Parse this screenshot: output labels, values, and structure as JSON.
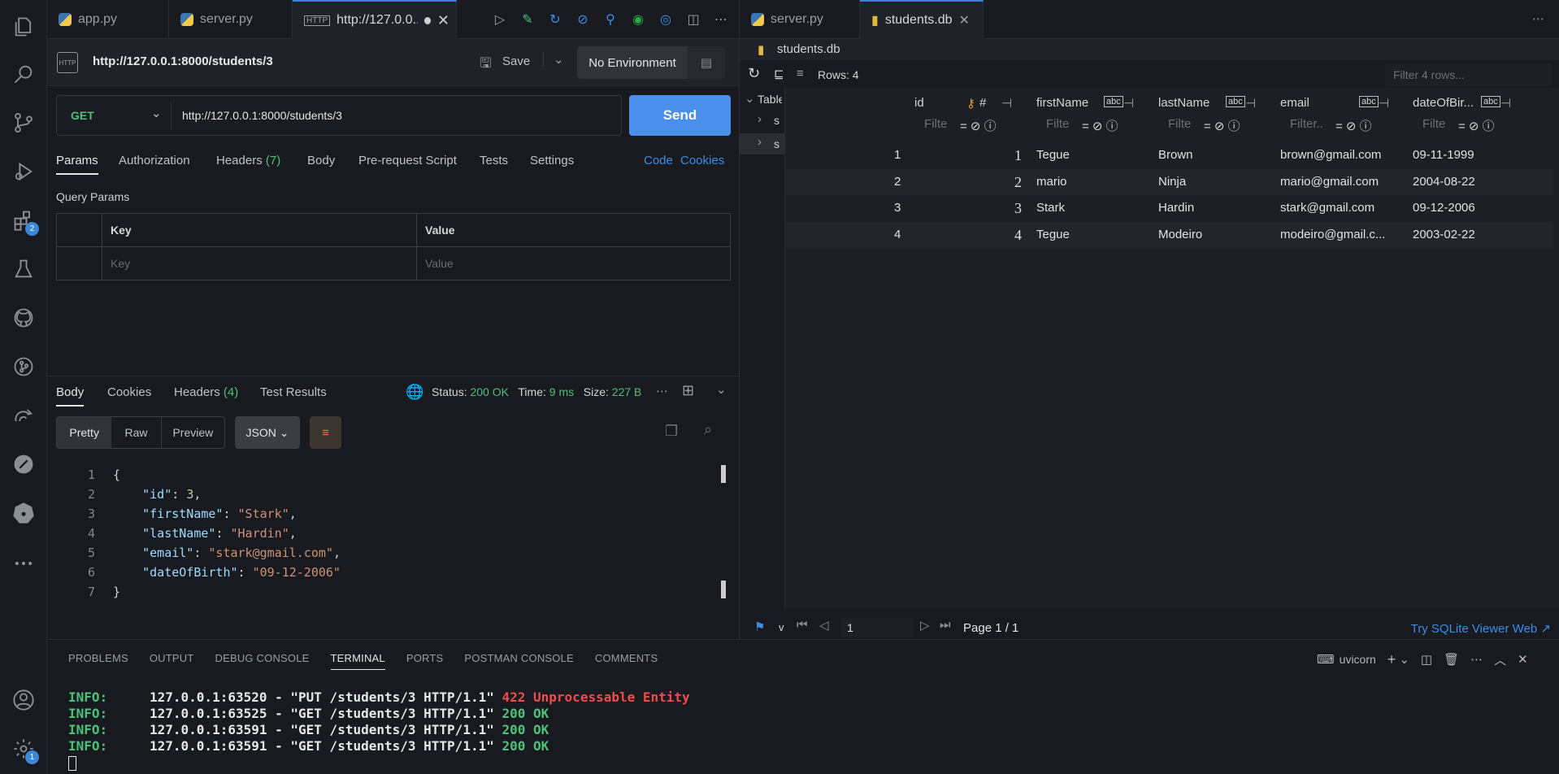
{
  "activity_bar": {
    "icons": [
      "files-icon",
      "search-icon",
      "source-control-icon",
      "run-debug-icon",
      "extensions-icon",
      "testing-icon",
      "github-icon",
      "git-graph-icon",
      "remote-icon",
      "postman-icon",
      "kubernetes-icon",
      "more-icon"
    ],
    "extensions_badge": "2",
    "settings_badge": "1",
    "bottom_icons": [
      "account-icon",
      "settings-gear-icon"
    ]
  },
  "left_tabs": [
    {
      "label": "app.py",
      "icon": "python-icon"
    },
    {
      "label": "server.py",
      "icon": "python-icon"
    },
    {
      "label": "http://127.0.0....",
      "icon": "http-icon",
      "active": true
    }
  ],
  "right_tabs": [
    {
      "label": "server.py",
      "icon": "python-icon"
    },
    {
      "label": "students.db",
      "icon": "database-icon",
      "active": true
    }
  ],
  "request": {
    "title": "http://127.0.0.1:8000/students/3",
    "save_label": "Save",
    "environment": "No Environment",
    "method": "GET",
    "url": "http://127.0.0.1:8000/students/3",
    "send_label": "Send",
    "tabs": [
      "Params",
      "Authorization",
      "Headers",
      "Body",
      "Pre-request Script",
      "Tests",
      "Settings"
    ],
    "headers_count": "(7)",
    "code_link": "Code",
    "cookies_link": "Cookies",
    "query_params_title": "Query Params",
    "key_header": "Key",
    "value_header": "Value",
    "key_placeholder": "Key",
    "value_placeholder": "Value"
  },
  "response": {
    "tabs": [
      "Body",
      "Cookies",
      "Headers",
      "Test Results"
    ],
    "headers_count": "(4)",
    "status_label": "Status:",
    "status_value": "200 OK",
    "time_label": "Time:",
    "time_value": "9 ms",
    "size_label": "Size:",
    "size_value": "227 B",
    "view_modes": [
      "Pretty",
      "Raw",
      "Preview"
    ],
    "format": "JSON",
    "body_lines": [
      {
        "n": "1",
        "text": "{"
      },
      {
        "n": "2",
        "key": "\"id\"",
        "val": "3",
        "type": "num",
        "comma": ","
      },
      {
        "n": "3",
        "key": "\"firstName\"",
        "val": "\"Stark\"",
        "type": "str",
        "comma": ","
      },
      {
        "n": "4",
        "key": "\"lastName\"",
        "val": "\"Hardin\"",
        "type": "str",
        "comma": ","
      },
      {
        "n": "5",
        "key": "\"email\"",
        "val": "\"stark@gmail.com\"",
        "type": "str",
        "comma": ","
      },
      {
        "n": "6",
        "key": "\"dateOfBirth\"",
        "val": "\"09-12-2006\"",
        "type": "str",
        "comma": ""
      },
      {
        "n": "7",
        "text": "}"
      }
    ]
  },
  "db": {
    "file": "students.db",
    "rows_label": "Rows: 4",
    "filter_placeholder": "Filter 4 rows...",
    "sidebar_label": "Table",
    "tree_items": [
      "s",
      "s"
    ],
    "columns": [
      "id",
      "firstName",
      "lastName",
      "email",
      "dateOfBir..."
    ],
    "column_filters": [
      "Filte",
      "Filte",
      "Filte",
      "Filter..",
      "Filte"
    ],
    "rows": [
      {
        "rownum": "1",
        "id": "1",
        "firstName": "Tegue",
        "lastName": "Brown",
        "email": "brown@gmail.com",
        "dob": "09-11-1999"
      },
      {
        "rownum": "2",
        "id": "2",
        "firstName": "mario",
        "lastName": "Ninja",
        "email": "mario@gmail.com",
        "dob": "2004-08-22"
      },
      {
        "rownum": "3",
        "id": "3",
        "firstName": "Stark",
        "lastName": "Hardin",
        "email": "stark@gmail.com",
        "dob": "09-12-2006"
      },
      {
        "rownum": "4",
        "id": "4",
        "firstName": "Tegue",
        "lastName": "Modeiro",
        "email": "modeiro@gmail.c...",
        "dob": "2003-02-22"
      }
    ],
    "footer_v": "v",
    "page_input": "1",
    "page_label": "Page 1 / 1",
    "try_link": "Try SQLite Viewer Web ↗"
  },
  "panel": {
    "tabs": [
      "PROBLEMS",
      "OUTPUT",
      "DEBUG CONSOLE",
      "TERMINAL",
      "PORTS",
      "POSTMAN CONSOLE",
      "COMMENTS"
    ],
    "active_tab": "TERMINAL",
    "terminal_name": "uvicorn",
    "lines": [
      {
        "level": "INFO:",
        "addr": "127.0.0.1:63520 - \"PUT /students/3 HTTP/1.1\"",
        "status": "422 Unprocessable Entity",
        "ok": false
      },
      {
        "level": "INFO:",
        "addr": "127.0.0.1:63525 - \"GET /students/3 HTTP/1.1\"",
        "status": "200 OK",
        "ok": true
      },
      {
        "level": "INFO:",
        "addr": "127.0.0.1:63591 - \"GET /students/3 HTTP/1.1\"",
        "status": "200 OK",
        "ok": true
      },
      {
        "level": "INFO:",
        "addr": "127.0.0.1:63591 - \"GET /students/3 HTTP/1.1\"",
        "status": "200 OK",
        "ok": true
      }
    ]
  },
  "colors": {
    "accent": "#3b8ee8",
    "send_button": "#4a8fea",
    "success": "#4ec07c",
    "error": "#f14c4c",
    "background": "#181a1f"
  }
}
